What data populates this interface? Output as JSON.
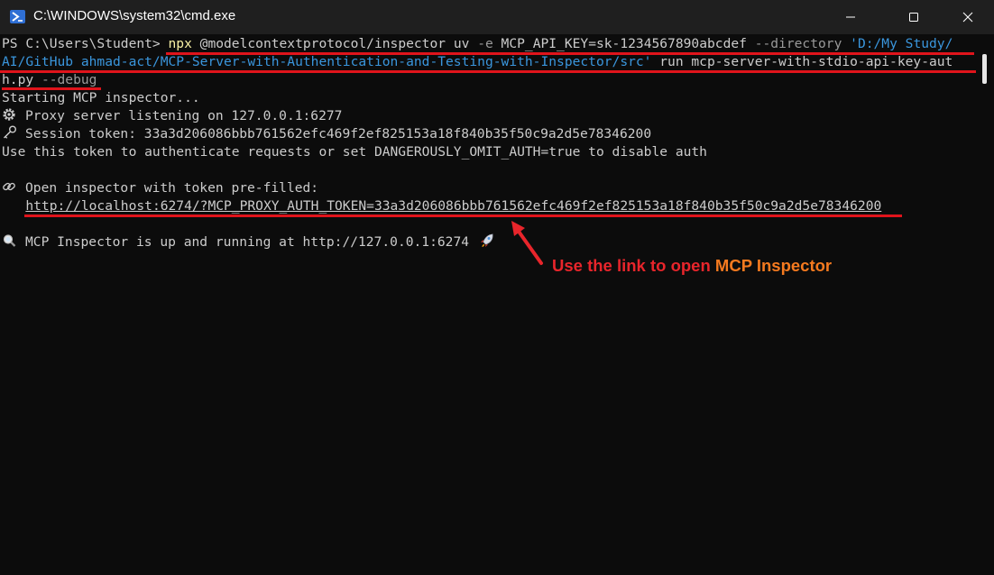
{
  "window": {
    "title": "C:\\WINDOWS\\system32\\cmd.exe",
    "controls": {
      "minimize": "minimize",
      "maximize": "maximize",
      "close": "close"
    }
  },
  "terminal": {
    "prompt": "PS C:\\Users\\Student> ",
    "cmd_npx": "npx",
    "cmd_pkg": " @modelcontextprotocol/inspector uv ",
    "flag_e": "-e",
    "env_val": " MCP_API_KEY=sk-1234567890abcdef ",
    "flag_dir": "--directory",
    "path_part1": " 'D:/My Study/",
    "path_part2": "AI/GitHub ahmad-act/MCP-Server-with-Authentication-and-Testing-with-Inspector/src'",
    "run_part1": " run mcp-server-with-stdio-api-key-aut",
    "run_part2": "h.py ",
    "flag_debug": "--debug",
    "starting": "Starting MCP inspector...",
    "proxy": "Proxy server listening on 127.0.0.1:6277",
    "session": "Session token: 33a3d206086bbb761562efc469f2ef825153a18f840b35f50c9a2d5e78346200",
    "use_token": "Use this token to authenticate requests or set DANGEROUSLY_OMIT_AUTH=true to disable auth",
    "open_inspector": "Open inspector with token pre-filled:",
    "link": "http://localhost:6274/?MCP_PROXY_AUTH_TOKEN=33a3d206086bbb761562efc469f2ef825153a18f840b35f50c9a2d5e78346200",
    "running": "MCP Inspector is up and running at http://127.0.0.1:6274 "
  },
  "annotation": {
    "text_main": "Use the link to open ",
    "text_highlight": "MCP Inspector"
  },
  "icons": [
    "powershell-icon",
    "gear-icon",
    "key-icon",
    "link-icon",
    "magnifier-icon",
    "rocket-icon"
  ],
  "colors": {
    "annotation_red": "#e8252b",
    "annotation_orange": "#f57a1f",
    "underline_red": "#e0141b"
  }
}
